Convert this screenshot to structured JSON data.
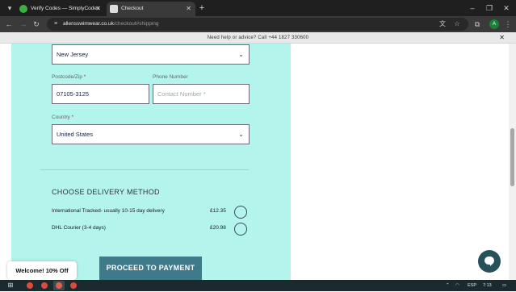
{
  "browser": {
    "tabs": [
      {
        "title": "Verify Codes — SimplyCodes",
        "active": false,
        "favicon_color": "#3cb043"
      },
      {
        "title": "Checkout",
        "active": true,
        "favicon_color": "#dddddd"
      }
    ],
    "url": {
      "host": "allensswimwear.co.uk",
      "path": "/checkout#shipping"
    },
    "profile_initial": "A",
    "icons": {
      "tab_menu": "tab-search-icon",
      "new_tab": "plus-icon",
      "back": "back-arrow-icon",
      "forward": "forward-arrow-icon",
      "reload": "reload-icon",
      "site_info": "tune-icon",
      "translate": "translate-icon",
      "bookmark": "star-icon",
      "extensions": "puzzle-icon",
      "menu": "kebab-menu-icon"
    }
  },
  "announcement": {
    "text": "Need help or advice? Call +44 1827 330600"
  },
  "form": {
    "state_value": "New Jersey",
    "postcode_label": "Postcode/Zip",
    "postcode_value": "07105-3125",
    "phone_label": "Phone Number",
    "phone_placeholder": "Contact Number *",
    "country_label": "Country",
    "country_value": "United States",
    "required_mark": "*"
  },
  "delivery": {
    "title": "CHOOSE DELIVERY METHOD",
    "options": [
      {
        "name": "International Tracked- usually 10-15 day delivery",
        "price": "£12.35",
        "selected": false
      },
      {
        "name": "DHL Courier (3-4 days)",
        "price": "£20.98",
        "selected": false
      }
    ]
  },
  "proceed_label": "PROCEED TO PAYMENT",
  "welcome_label": "Welcome! 10% Off",
  "colors": {
    "panel": "#b3f5ec",
    "button": "#3f7a8a",
    "chat": "#27515b"
  },
  "taskbar": {
    "language": "ESP",
    "time": "7:13"
  }
}
